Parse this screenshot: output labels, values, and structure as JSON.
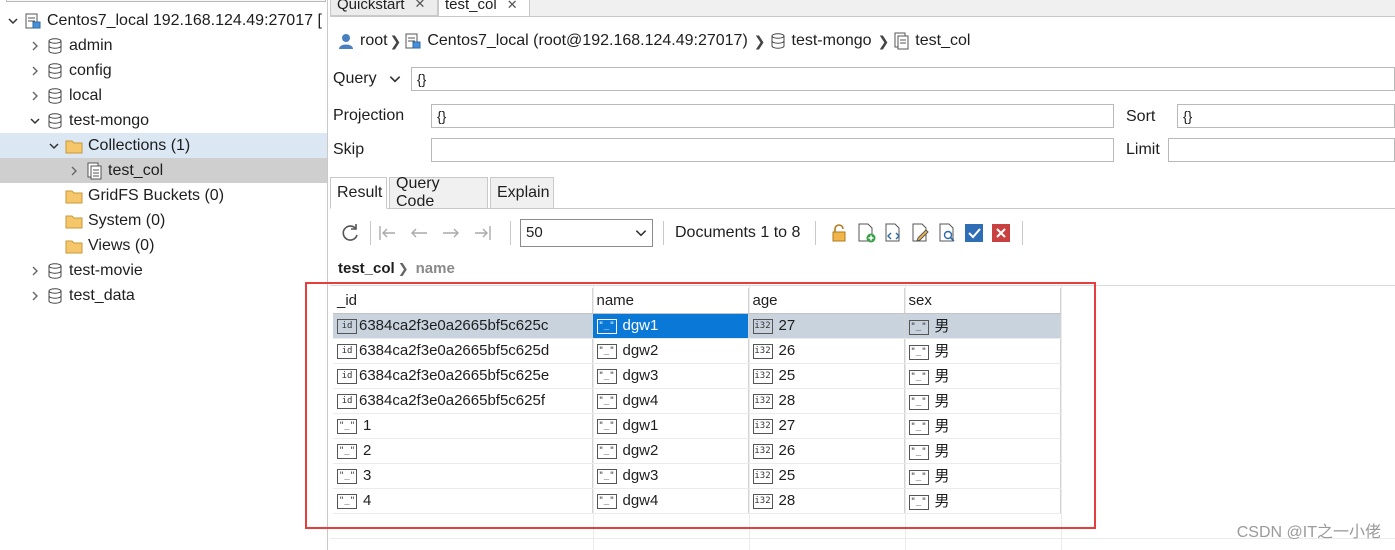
{
  "tree": {
    "items": [
      {
        "label": "Centos7_local 192.168.124.49:27017 [",
        "expanded": true,
        "icon": "server-icon"
      },
      {
        "label": "admin",
        "icon": "database-icon"
      },
      {
        "label": "config",
        "icon": "database-icon"
      },
      {
        "label": "local",
        "icon": "database-icon"
      },
      {
        "label": "test-mongo",
        "expanded": true,
        "icon": "database-icon"
      },
      {
        "label": "Collections (1)",
        "expanded": true,
        "icon": "folder-icon"
      },
      {
        "label": "test_col",
        "icon": "collection-icon"
      },
      {
        "label": "GridFS Buckets (0)",
        "icon": "folder-icon"
      },
      {
        "label": "System (0)",
        "icon": "folder-icon"
      },
      {
        "label": "Views (0)",
        "icon": "folder-icon"
      },
      {
        "label": "test-movie",
        "icon": "database-icon"
      },
      {
        "label": "test_data",
        "icon": "database-icon"
      }
    ]
  },
  "tabs": [
    {
      "label": "Quickstart"
    },
    {
      "label": "test_col",
      "active": true
    }
  ],
  "breadcrumb": {
    "user": "root",
    "connection": "Centos7_local (root@192.168.124.49:27017)",
    "database": "test-mongo",
    "collection": "test_col"
  },
  "query": {
    "query_label": "Query",
    "query_value": "{}",
    "projection_label": "Projection",
    "projection_value": "{}",
    "sort_label": "Sort",
    "sort_value": "{}",
    "skip_label": "Skip",
    "skip_value": "",
    "limit_label": "Limit",
    "limit_value": ""
  },
  "result_tabs": [
    {
      "label": "Result",
      "active": true
    },
    {
      "label": "Query Code"
    },
    {
      "label": "Explain"
    }
  ],
  "toolbar": {
    "page_size": "50",
    "documents_text": "Documents 1 to 8"
  },
  "result_path": {
    "collection": "test_col",
    "field": "name"
  },
  "grid": {
    "columns": [
      "_id",
      "name",
      "age",
      "sex"
    ],
    "rows": [
      {
        "id_type": "id",
        "id": "6384ca2f3e0a2665bf5c625c",
        "name": "dgw1",
        "age": "27",
        "sex": "男",
        "selected": true
      },
      {
        "id_type": "id",
        "id": "6384ca2f3e0a2665bf5c625d",
        "name": "dgw2",
        "age": "26",
        "sex": "男"
      },
      {
        "id_type": "id",
        "id": "6384ca2f3e0a2665bf5c625e",
        "name": "dgw3",
        "age": "25",
        "sex": "男"
      },
      {
        "id_type": "id",
        "id": "6384ca2f3e0a2665bf5c625f",
        "name": "dgw4",
        "age": "28",
        "sex": "男"
      },
      {
        "id_type": "str",
        "id": "1",
        "name": "dgw1",
        "age": "27",
        "sex": "男"
      },
      {
        "id_type": "str",
        "id": "2",
        "name": "dgw2",
        "age": "26",
        "sex": "男"
      },
      {
        "id_type": "str",
        "id": "3",
        "name": "dgw3",
        "age": "25",
        "sex": "男"
      },
      {
        "id_type": "str",
        "id": "4",
        "name": "dgw4",
        "age": "28",
        "sex": "男"
      }
    ],
    "type_badges": {
      "id": "id",
      "str": "\"_\"",
      "int": "i32"
    }
  },
  "watermark": "CSDN @IT之一小佬",
  "colors": {
    "selection_focus": "#0a78d7",
    "selection_row": "#c8d3de",
    "annotation_box": "#e53e3e"
  }
}
